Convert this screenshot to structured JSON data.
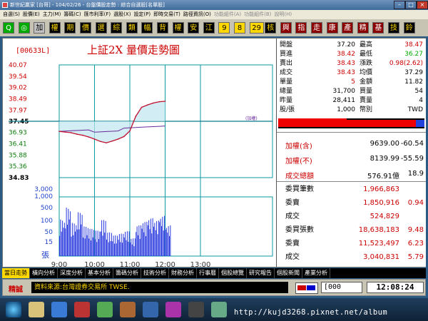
{
  "window": {
    "title": "新世紀贏家 [台哥] - 104/02/26 - 台盤價股走勢 : 綜合自選股[名單股]"
  },
  "menu": [
    "自選(S)",
    "股價(E)",
    "主力(M)",
    "籌碼(C)",
    "匯市利率(F)",
    "選股(X)",
    "設定(P)",
    "即時交易(T)",
    "路徑資訊(O)",
    "功能組件(A)",
    "功能組件(B)",
    "說明(H)"
  ],
  "toolbar": {
    "buttons": [
      "Q",
      "◎",
      "加",
      "權",
      "期",
      "價",
      "選",
      "綜",
      "類",
      "幅",
      "背",
      "權",
      "安",
      "江",
      "9",
      "8",
      "29",
      "核",
      "興",
      "指",
      "走",
      "康",
      "產",
      "精",
      "基",
      "技",
      "鈴"
    ]
  },
  "chart": {
    "code": "[00633L]",
    "title": "上証2X  量價走勢圖",
    "note": "(加權)",
    "price_ticks": [
      "40.07",
      "39.54",
      "39.02",
      "38.49",
      "37.97",
      "37.45",
      "36.93",
      "36.41",
      "35.88",
      "35.36",
      "34.83"
    ],
    "ref_price": "37.45",
    "volume_ticks": [
      "3,000",
      "1,000",
      "500",
      "100",
      "50",
      "15"
    ],
    "volume_unit": "張",
    "time_ticks": [
      "9:00",
      "10:00",
      "11:00",
      "12:00",
      "13:00"
    ],
    "price_color": "#c01030",
    "index_color": "#6a2a9a"
  },
  "chart_data": {
    "type": "line",
    "x": [
      "09:00",
      "09:10",
      "09:20",
      "09:30",
      "09:40",
      "09:50",
      "10:00",
      "10:10",
      "10:20",
      "10:30",
      "10:40",
      "10:50",
      "11:00",
      "11:10",
      "11:20",
      "11:30",
      "11:40",
      "11:50",
      "12:00"
    ],
    "series": [
      {
        "values": [
          36.98,
          36.95,
          36.92,
          36.85,
          36.8,
          36.72,
          36.62,
          36.51,
          36.45,
          36.53,
          36.62,
          36.74,
          37.0,
          37.68,
          38.1,
          38.21,
          38.3,
          38.36,
          38.38
        ]
      }
    ],
    "ylim": [
      34.83,
      40.07
    ],
    "ref_line": 37.45,
    "volume_values": [
      620,
      820,
      560,
      740,
      500,
      460,
      430,
      610,
      400,
      350,
      380,
      420,
      300,
      520,
      580,
      640,
      600,
      680,
      520
    ]
  },
  "quote": {
    "rows": [
      {
        "l1": "開盤",
        "v1": "37.20",
        "c1": "#000",
        "l2": "最高",
        "v2": "38.47",
        "c2": "#c00"
      },
      {
        "l1": "買進",
        "v1": "38.42",
        "c1": "#c00",
        "l2": "最低",
        "v2": "36.27",
        "c2": "#0a0"
      },
      {
        "l1": "賣出",
        "v1": "38.43",
        "c1": "#c00",
        "l2": "漲跌",
        "v2": "0.98(2.62)",
        "c2": "#c00"
      },
      {
        "l1": "成交",
        "v1": "38.43",
        "c1": "#c00",
        "l2": "均價",
        "v2": "37.29",
        "c2": "#000"
      },
      {
        "l1": "單量",
        "v1": "5",
        "c1": "#c00",
        "l2": "金額",
        "v2": "11.82",
        "c2": "#000"
      },
      {
        "l1": "總量",
        "v1": "31,700",
        "c1": "#000",
        "l2": "買量",
        "v2": "54",
        "c2": "#000"
      },
      {
        "l1": "昨量",
        "v1": "28,411",
        "c1": "#000",
        "l2": "賣量",
        "v2": "4",
        "c2": "#000"
      },
      {
        "l1": "股/張",
        "v1": "1,000",
        "c1": "#000",
        "l2": "幣別",
        "v2": "TWD",
        "c2": "#000"
      }
    ],
    "bar_buy_pct": 94
  },
  "index_block": [
    {
      "l": "加權(含)",
      "v1": "9639.00",
      "v2": "-60.54",
      "lc": "#c00",
      "vc": "#000"
    },
    {
      "l": "加權(不)",
      "v1": "8139.99",
      "v2": "-55.59",
      "lc": "#c00",
      "vc": "#000"
    },
    {
      "l": "成交總額",
      "v1": "576.91億",
      "v2": "18.9",
      "lc": "#c00",
      "vc": "#000"
    }
  ],
  "order_block": [
    {
      "l": "委買筆數",
      "v1": "1,966,863",
      "v2": ""
    },
    {
      "l": "委賣",
      "v1": "1,850,916",
      "v2": "0.94"
    },
    {
      "l": "成交",
      "v1": "524,829",
      "v2": ""
    },
    {
      "l": "委買張數",
      "v1": "18,638,183",
      "v2": "9.48"
    },
    {
      "l": "委賣",
      "v1": "11,523,497",
      "v2": "6.23"
    },
    {
      "l": "成交",
      "v1": "3,040,831",
      "v2": "5.79"
    }
  ],
  "tabs": [
    "當日走勢",
    "橫向分析",
    "深度分析",
    "基本分析",
    "籌碼分析",
    "技術分析",
    "財務分析",
    "行事曆",
    "個股總覽",
    "研究報告",
    "個股新聞",
    "產業分析"
  ],
  "status": {
    "label": "精誠",
    "source": "資料來源:台灣證券交易所 TWSE.",
    "code": "[000",
    "time": "12:08:24"
  },
  "watermark_url": "http://kujd3268.pixnet.net/album"
}
